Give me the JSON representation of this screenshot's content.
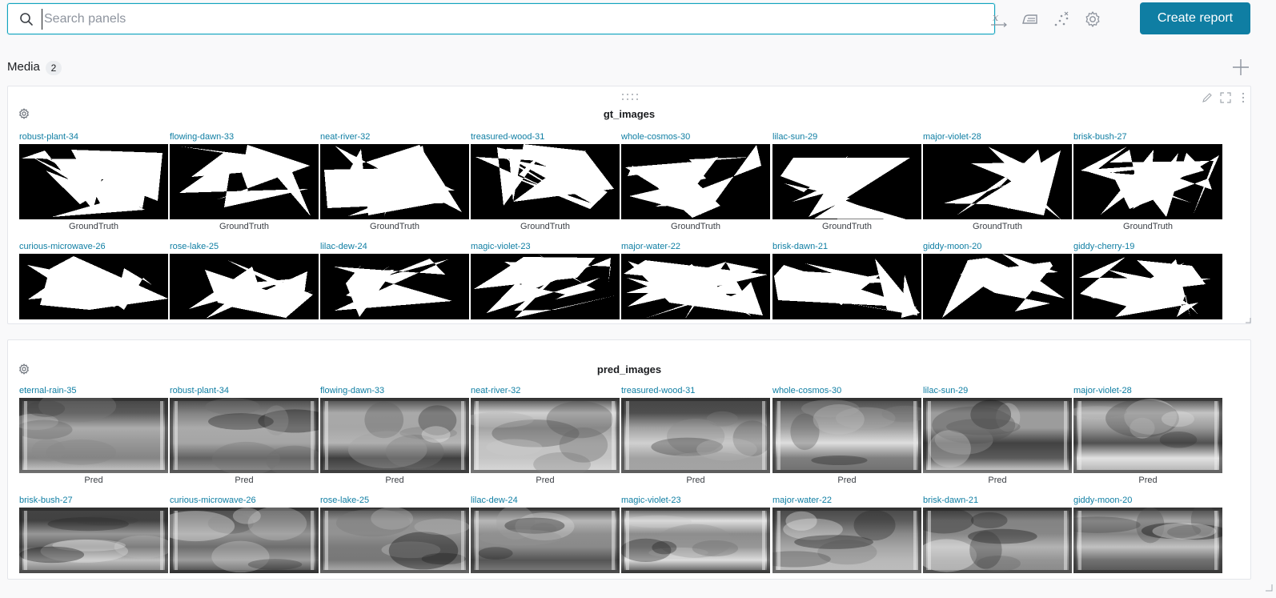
{
  "search": {
    "placeholder": "Search panels",
    "value": ""
  },
  "toolbar": {
    "tools": [
      "x-axis-icon",
      "iron-icon",
      "scatter-icon",
      "gear-icon"
    ],
    "create_label": "Create report"
  },
  "section": {
    "title": "Media",
    "count": "2"
  },
  "gt_panel": {
    "title": "gt_images",
    "caption": "GroundTruth",
    "row1": [
      "robust-plant-34",
      "flowing-dawn-33",
      "neat-river-32",
      "treasured-wood-31",
      "whole-cosmos-30",
      "lilac-sun-29",
      "major-violet-28",
      "brisk-bush-27"
    ],
    "row2": [
      "curious-microwave-26",
      "rose-lake-25",
      "lilac-dew-24",
      "magic-violet-23",
      "major-water-22",
      "brisk-dawn-21",
      "giddy-moon-20",
      "giddy-cherry-19"
    ]
  },
  "pred_panel": {
    "title": "pred_images",
    "caption": "Pred",
    "row1": [
      "eternal-rain-35",
      "robust-plant-34",
      "flowing-dawn-33",
      "neat-river-32",
      "treasured-wood-31",
      "whole-cosmos-30",
      "lilac-sun-29",
      "major-violet-28"
    ],
    "row2": [
      "brisk-bush-27",
      "curious-microwave-26",
      "rose-lake-25",
      "lilac-dew-24",
      "magic-violet-23",
      "major-water-22",
      "brisk-dawn-21",
      "giddy-moon-20"
    ]
  },
  "colors": {
    "accent": "#0f7ea3",
    "link": "#0f7ea3",
    "focus": "#10a4bf"
  }
}
